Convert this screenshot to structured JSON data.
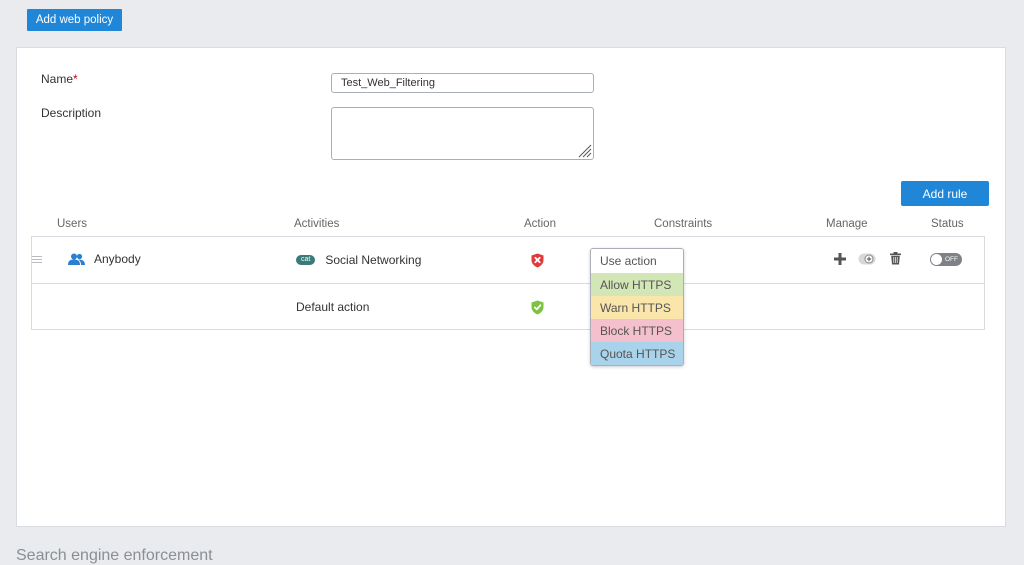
{
  "top_button": "Add web policy",
  "form": {
    "name_label": "Name",
    "name_required_mark": "*",
    "name_value": "Test_Web_Filtering",
    "description_label": "Description",
    "description_value": ""
  },
  "add_rule": "Add rule",
  "columns": [
    "Users",
    "Activities",
    "Action",
    "Constraints",
    "Manage",
    "Status"
  ],
  "rules": [
    {
      "user": "Anybody",
      "activity_badge": "cat",
      "activity": "Social Networking",
      "action": "block",
      "status": "OFF"
    },
    {
      "activity": "Default action",
      "action": "allow"
    }
  ],
  "constraint_options": [
    {
      "label": "Use action",
      "color": "#ffffff"
    },
    {
      "label": "Allow HTTPS",
      "color": "#d3e6b6"
    },
    {
      "label": "Warn HTTPS",
      "color": "#fae5aa"
    },
    {
      "label": "Block HTTPS",
      "color": "#f5c0cd"
    },
    {
      "label": "Quota HTTPS",
      "color": "#a9d3ea"
    }
  ],
  "icons": {
    "users": "users-icon",
    "block": "shield-x-icon",
    "allow": "shield-check-icon",
    "add": "plus-icon",
    "insert": "insert-rule-icon",
    "delete": "trash-icon",
    "drag": "drag-handle-icon"
  },
  "colors": {
    "primary": "#1f86d8",
    "block": "#e03b3b",
    "allow": "#7cc243",
    "badge": "#3a7a78"
  },
  "next_section_title": "Search engine enforcement"
}
